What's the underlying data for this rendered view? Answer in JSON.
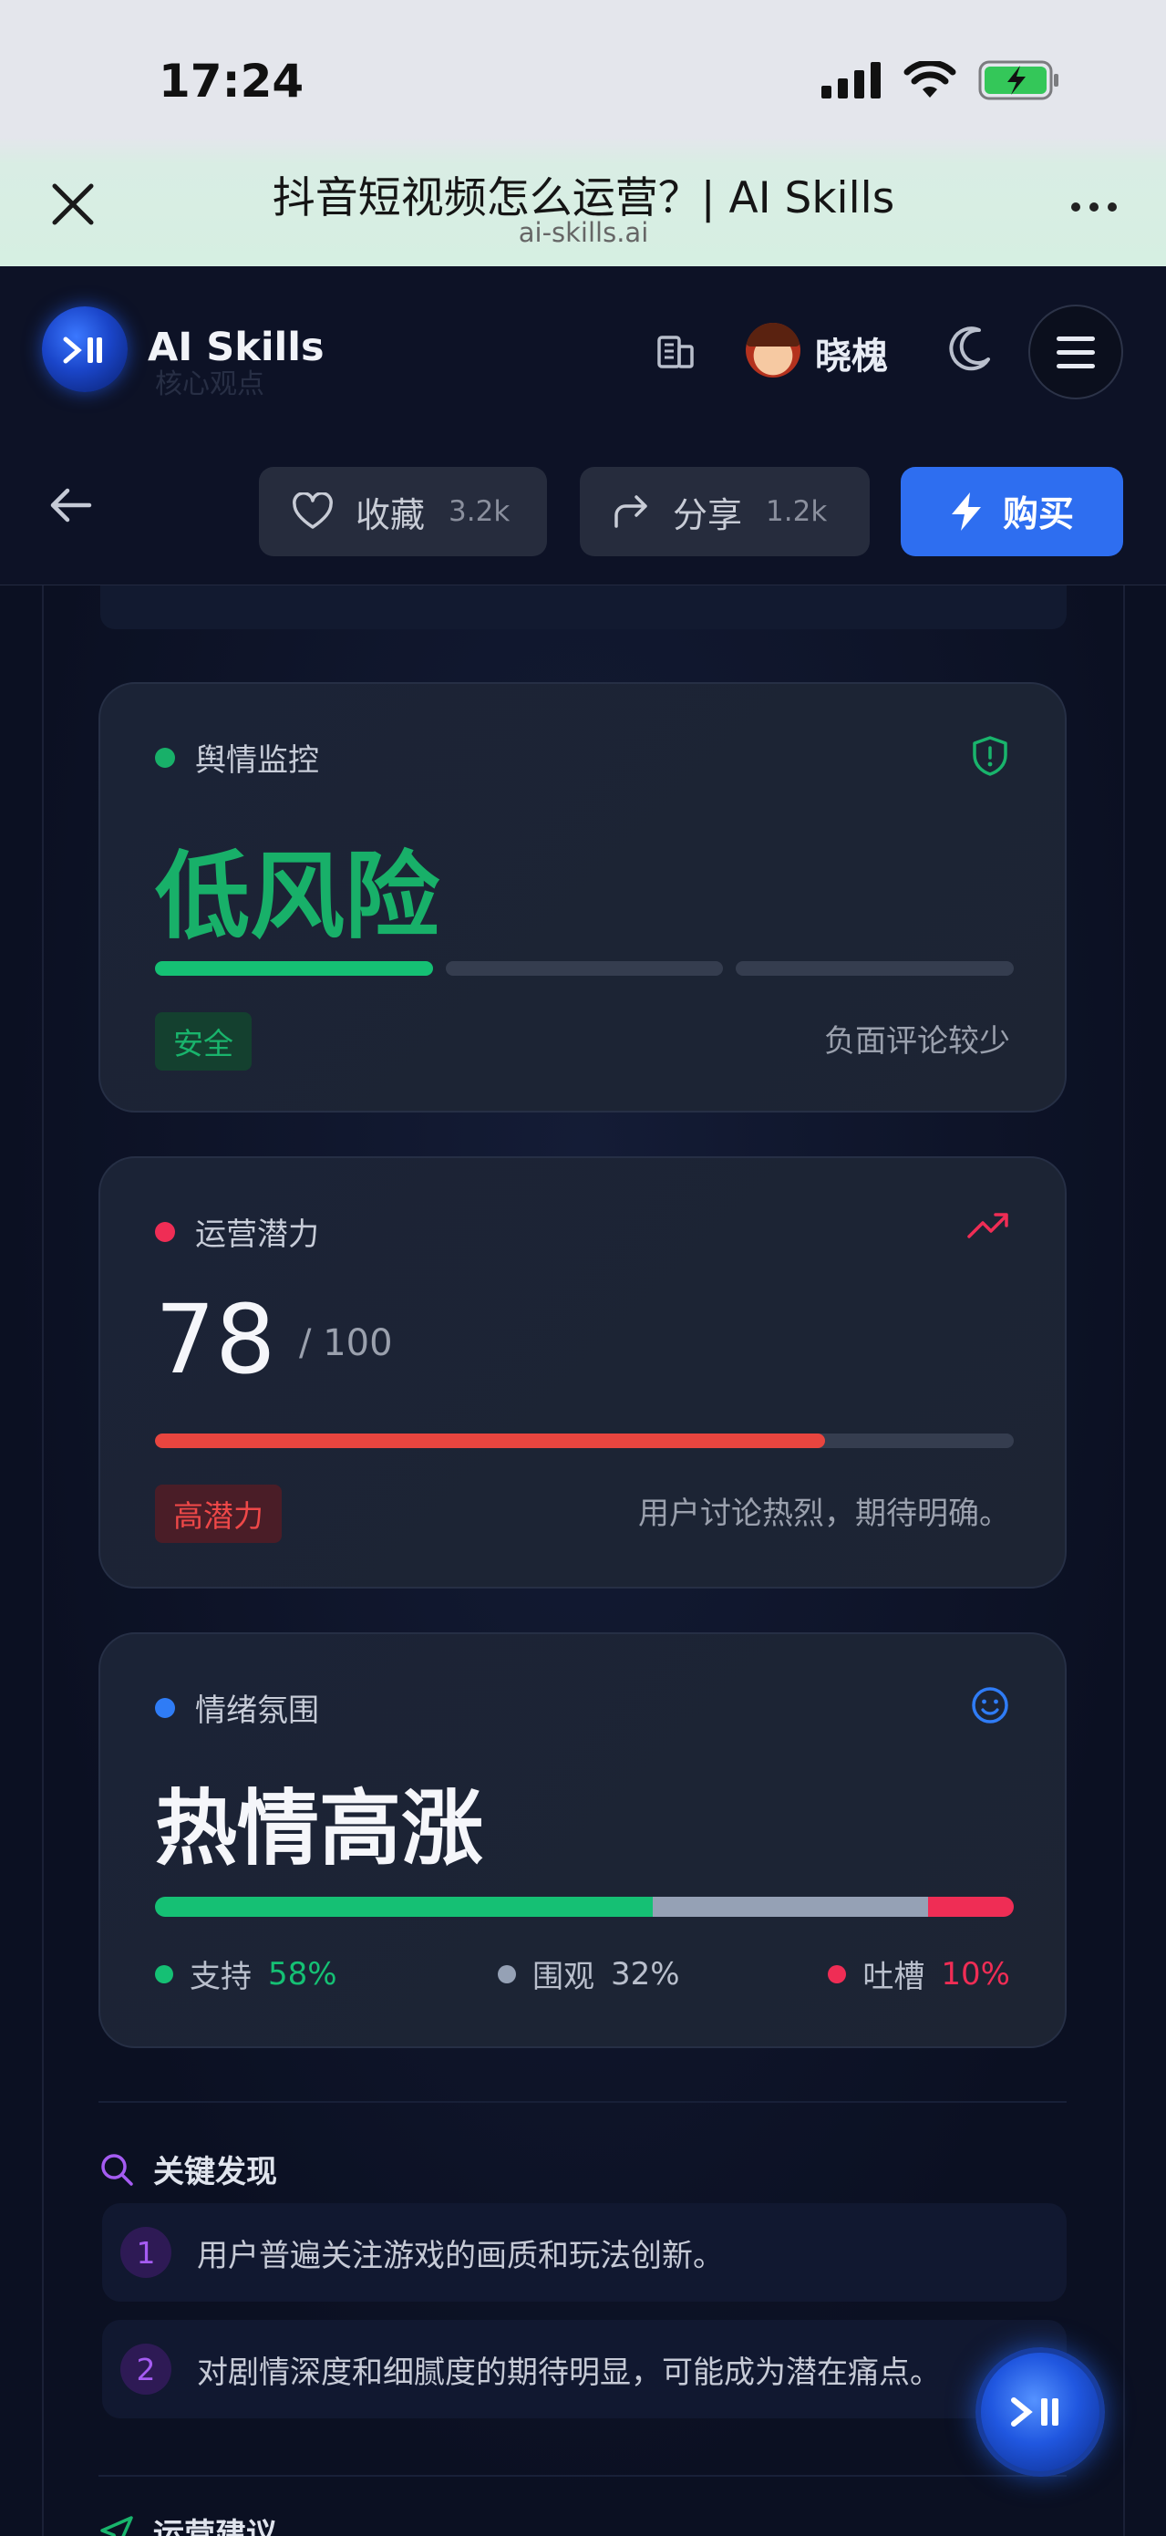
{
  "status_bar": {
    "time": "17:24"
  },
  "browser": {
    "title": "抖音短视频怎么运营？| AI Skills",
    "url": "ai-skills.ai"
  },
  "header": {
    "brand": "AI Skills",
    "brand_ghost": "核心观点",
    "username": "晓槐",
    "actions": {
      "favorite_label": "收藏",
      "favorite_count": "3.2k",
      "share_label": "分享",
      "share_count": "1.2k",
      "buy_label": "购买"
    }
  },
  "cards": {
    "sentiment_monitor": {
      "title": "舆情监控",
      "value": "低风险",
      "tag": "安全",
      "note": "负面评论较少",
      "risk_level_segments_active": 1,
      "segments_total": 3,
      "colors": {
        "dot": "#18b069",
        "value": "#18b069"
      }
    },
    "potential": {
      "title": "运营潜力",
      "score": "78",
      "max": "/ 100",
      "progress": 0.78,
      "tag": "高潜力",
      "note": "用户讨论热烈，期待明确。",
      "colors": {
        "dot": "#ef2d55",
        "bar": "#e8453f"
      }
    },
    "mood": {
      "title": "情绪氛围",
      "value": "热情高涨",
      "breakdown": [
        {
          "label": "支持",
          "value": "58%",
          "share": 58,
          "color": "#15c074"
        },
        {
          "label": "围观",
          "value": "32%",
          "share": 32,
          "color": "#95a1b5"
        },
        {
          "label": "吐槽",
          "value": "10%",
          "share": 10,
          "color": "#ef2d55"
        }
      ]
    }
  },
  "key_findings": {
    "title": "关键发现",
    "items": [
      {
        "num": "1",
        "text": "用户普遍关注游戏的画质和玩法创新。"
      },
      {
        "num": "2",
        "text": "对剧情深度和细腻度的期待明显，可能成为潜在痛点。"
      }
    ]
  },
  "next_section": {
    "title": "运营建议"
  },
  "icons": [
    "close-icon",
    "more-icon",
    "building-icon",
    "moon-icon",
    "menu-icon",
    "back-arrow-icon",
    "heart-icon",
    "share-icon",
    "bolt-icon",
    "shield-icon",
    "trending-up-icon",
    "smile-icon",
    "search-icon",
    "send-icon"
  ]
}
